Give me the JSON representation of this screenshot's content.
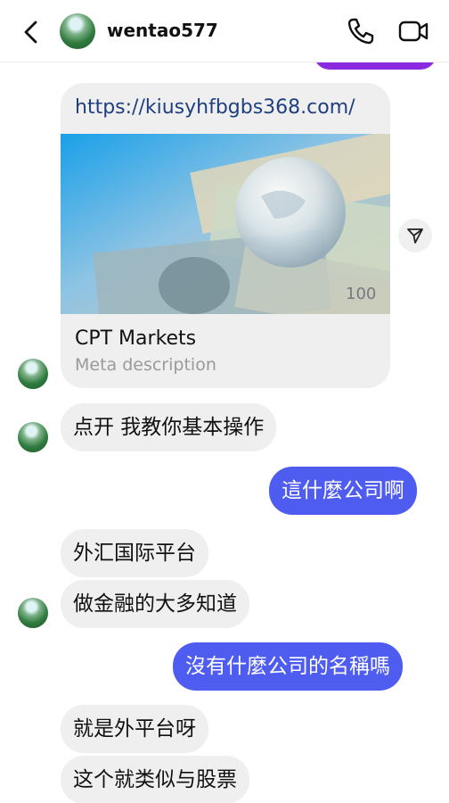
{
  "header": {
    "username": "wentao577",
    "icons": {
      "back": "chevron-left-icon",
      "call": "phone-icon",
      "video": "video-camera-icon"
    }
  },
  "link_preview": {
    "url": "https://kiusyhfbgbs368.com/",
    "title": "CPT Markets",
    "description": "Meta description",
    "image": "globe-on-dollar-bills"
  },
  "messages": [
    {
      "side": "incoming",
      "text": "点开 我教你基本操作"
    },
    {
      "side": "outgoing",
      "text": "這什麼公司啊"
    },
    {
      "side": "incoming",
      "text": "外汇国际平台"
    },
    {
      "side": "incoming",
      "text": "做金融的大多知道"
    },
    {
      "side": "outgoing",
      "text": "沒有什麼公司的名稱嗎"
    },
    {
      "side": "incoming",
      "text": "就是外平台呀"
    },
    {
      "side": "incoming",
      "text": "这个就类似与股票"
    }
  ],
  "colors": {
    "outgoing_bubble": "#4f5cf0",
    "incoming_bubble": "#efefef",
    "previous_bubble": "#8a2be2",
    "link": "#1f3f80"
  }
}
